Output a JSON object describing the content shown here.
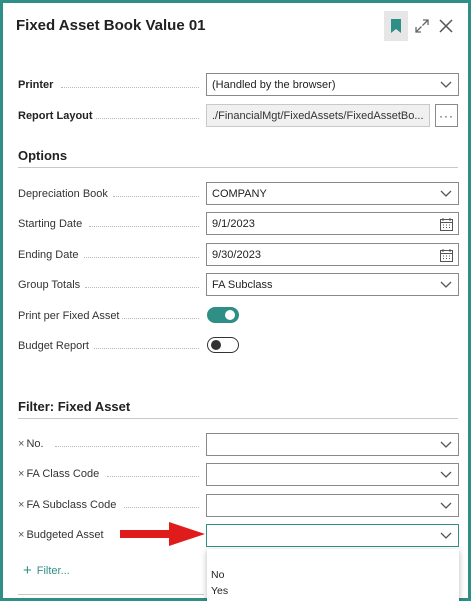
{
  "dialog": {
    "title": "Fixed Asset Book Value 01"
  },
  "printer": {
    "label": "Printer",
    "value": "(Handled by the browser)"
  },
  "report_layout": {
    "label": "Report Layout",
    "value": "./FinancialMgt/FixedAssets/FixedAssetBo...",
    "more_label": "···"
  },
  "options": {
    "heading": "Options",
    "depreciation_book": {
      "label": "Depreciation Book",
      "value": "COMPANY"
    },
    "starting_date": {
      "label": "Starting Date",
      "value": "9/1/2023"
    },
    "ending_date": {
      "label": "Ending Date",
      "value": "9/30/2023"
    },
    "group_totals": {
      "label": "Group Totals",
      "value": "FA Subclass"
    },
    "print_per_fixed_asset": {
      "label": "Print per Fixed Asset",
      "on": true
    },
    "budget_report": {
      "label": "Budget Report",
      "on": false
    }
  },
  "filter": {
    "heading": "Filter: Fixed Asset",
    "fields": [
      {
        "label": "No.",
        "value": ""
      },
      {
        "label": "FA Class Code",
        "value": ""
      },
      {
        "label": "FA Subclass Code",
        "value": ""
      },
      {
        "label": "Budgeted Asset",
        "value": ""
      }
    ],
    "add_filter_label": "Filter...",
    "dropdown_options": [
      "No",
      "Yes"
    ]
  },
  "colors": {
    "accent": "#2f8f86",
    "annotation_arrow": "#e01b1b"
  },
  "icons": [
    "bookmark-icon",
    "expand-icon",
    "close-icon",
    "chevron-down-icon",
    "calendar-icon",
    "clear-filter-icon",
    "plus-icon"
  ]
}
